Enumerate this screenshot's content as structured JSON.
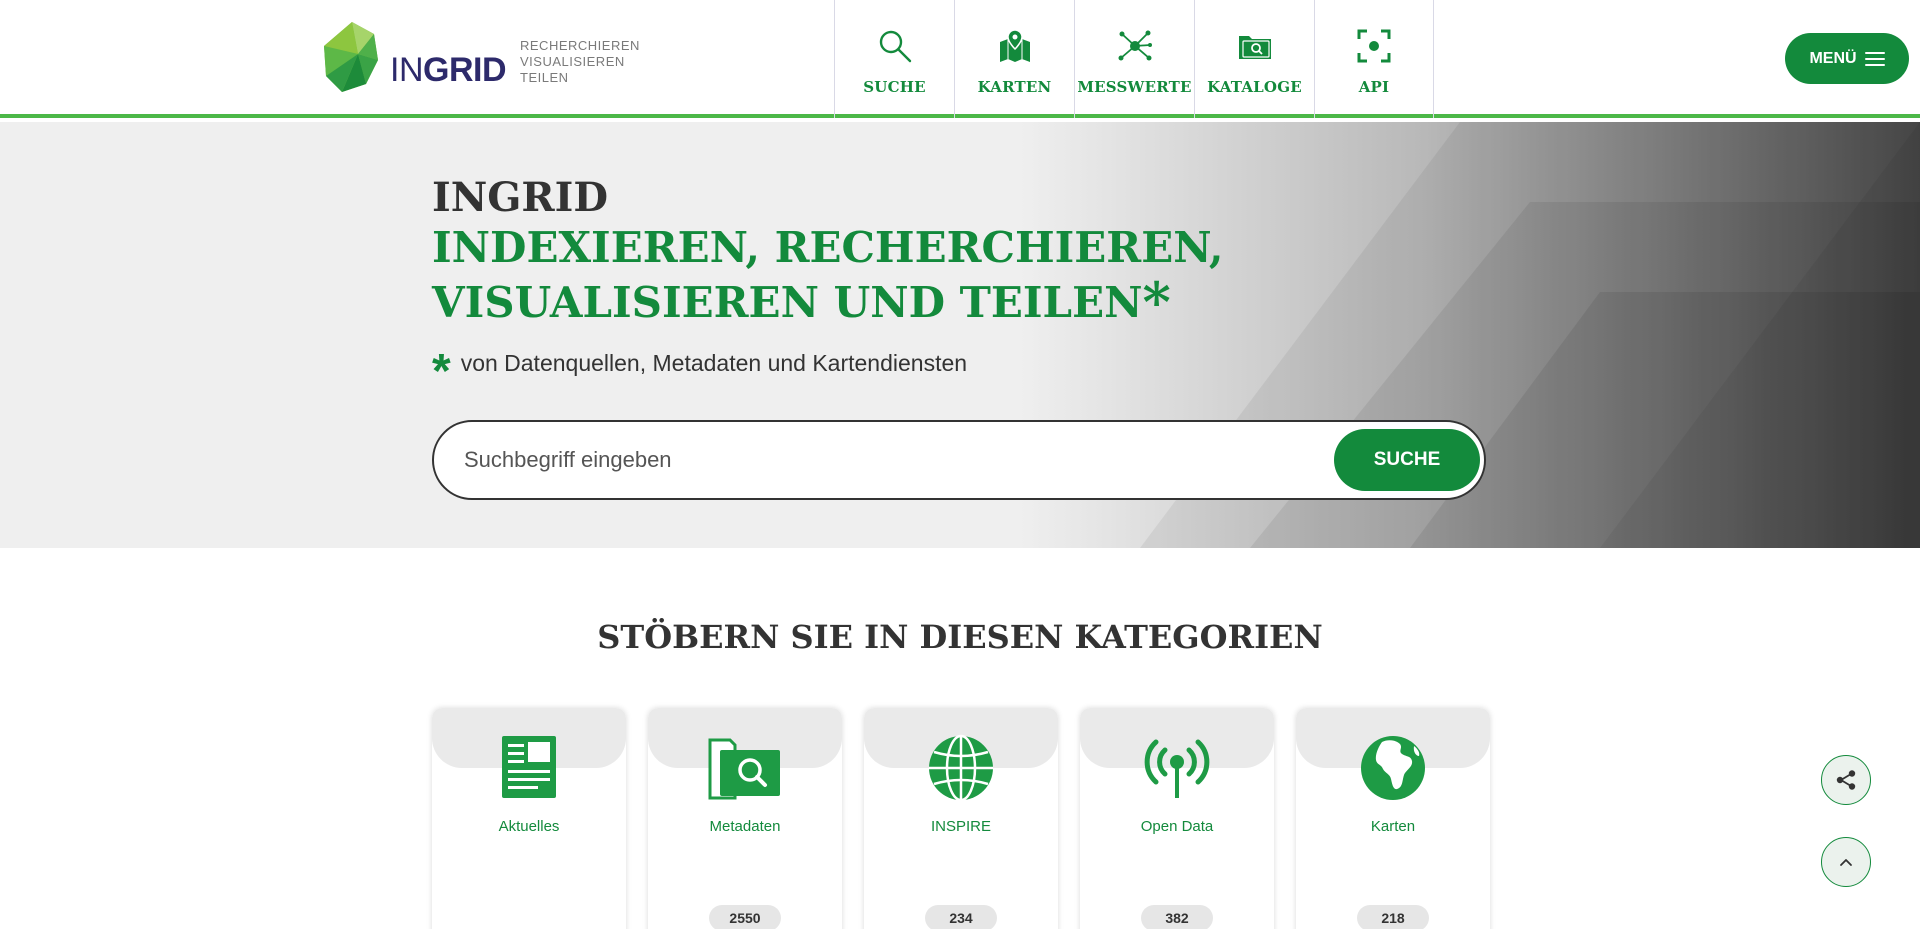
{
  "brand": {
    "name_in": "IN",
    "name_grid": "GRID",
    "tagline": [
      "RECHERCHIEREN",
      "VISUALISIEREN",
      "TEILEN"
    ],
    "green": "#138a3c",
    "accent_line": "#4cb848",
    "navy": "#2d2a6b"
  },
  "nav": {
    "items": [
      {
        "label": "SUCHE",
        "icon": "search-icon"
      },
      {
        "label": "KARTEN",
        "icon": "map-icon"
      },
      {
        "label": "MESSWERTE",
        "icon": "network-icon"
      },
      {
        "label": "KATALOGE",
        "icon": "catalog-folder-icon"
      },
      {
        "label": "API",
        "icon": "api-focus-icon"
      }
    ],
    "menu_label": "MENÜ"
  },
  "hero": {
    "title": "INGRID",
    "subtitle": "INDEXIEREN, RECHERCHIEREN, VISUALISIEREN UND TEILEN",
    "subtitle_star": "*",
    "note_star": "*",
    "note": "von Datenquellen, Metadaten und Kartendiensten",
    "search_placeholder": "Suchbegriff eingeben",
    "search_button": "SUCHE"
  },
  "categories": {
    "heading": "STÖBERN SIE IN DIESEN KATEGORIEN",
    "items": [
      {
        "label": "Aktuelles",
        "count": "",
        "icon": "news-icon"
      },
      {
        "label": "Metadaten",
        "count": "2550",
        "icon": "metadata-folder-search-icon"
      },
      {
        "label": "INSPIRE",
        "count": "234",
        "icon": "globe-icon"
      },
      {
        "label": "Open Data",
        "count": "382",
        "icon": "broadcast-antenna-icon"
      },
      {
        "label": "Karten",
        "count": "218",
        "icon": "earth-africa-icon"
      }
    ]
  },
  "floating": {
    "share_icon": "share-icon",
    "top_icon": "chevron-up-icon"
  }
}
